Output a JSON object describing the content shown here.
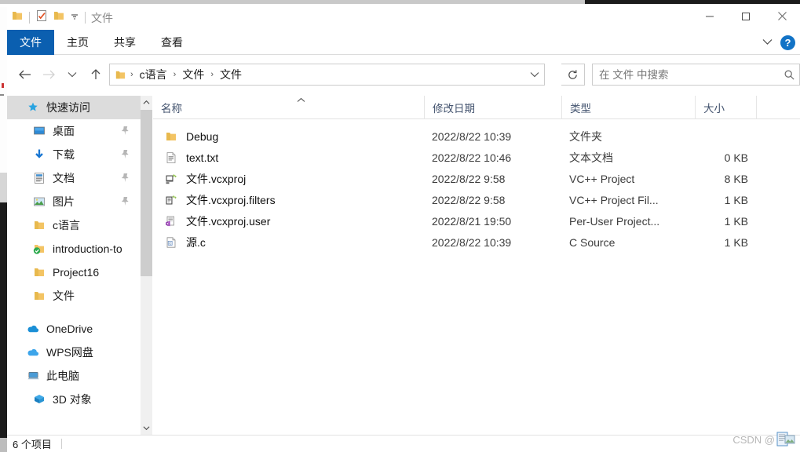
{
  "window": {
    "title": "文件",
    "quick_access": [
      {
        "name": "folder-icon",
        "label": "文件夹"
      },
      {
        "name": "properties-icon",
        "label": "属性"
      },
      {
        "name": "new-folder-icon",
        "label": "新建文件夹"
      },
      {
        "name": "customize-qat-caret",
        "label": "自定义快速访问工具栏"
      }
    ],
    "controls": [
      {
        "name": "minimize-button",
        "label": "最小化"
      },
      {
        "name": "maximize-button",
        "label": "最大化"
      },
      {
        "name": "close-button",
        "label": "关闭"
      }
    ]
  },
  "ribbon": {
    "tabs": [
      {
        "label": "文件",
        "active": true
      },
      {
        "label": "主页",
        "active": false
      },
      {
        "label": "共享",
        "active": false
      },
      {
        "label": "查看",
        "active": false
      }
    ],
    "expand_caret": "⌄",
    "help_label": "?"
  },
  "navigation": {
    "back_label": "←",
    "forward_label": "→",
    "recent_label": "⌄",
    "up_label": "↑",
    "refresh_label": "↻",
    "breadcrumb": [
      "c语言",
      "文件",
      "文件"
    ],
    "breadcrumb_separator": "›",
    "address_caret": "⌄"
  },
  "search": {
    "placeholder": "在 文件 中搜索",
    "value": "",
    "icon": "search-icon"
  },
  "sidebar": {
    "items": [
      {
        "label": "快速访问",
        "icon": "quick-access-star-icon",
        "selected": true,
        "pinned": false,
        "indent": false
      },
      {
        "label": "桌面",
        "icon": "desktop-icon",
        "selected": false,
        "pinned": true,
        "indent": true
      },
      {
        "label": "下载",
        "icon": "downloads-icon",
        "selected": false,
        "pinned": true,
        "indent": true
      },
      {
        "label": "文档",
        "icon": "documents-icon",
        "selected": false,
        "pinned": true,
        "indent": true
      },
      {
        "label": "图片",
        "icon": "pictures-icon",
        "selected": false,
        "pinned": true,
        "indent": true
      },
      {
        "label": "c语言",
        "icon": "folder-icon",
        "selected": false,
        "pinned": false,
        "indent": true
      },
      {
        "label": "introduction-to",
        "icon": "synced-folder-icon",
        "selected": false,
        "pinned": false,
        "indent": true
      },
      {
        "label": "Project16",
        "icon": "folder-icon",
        "selected": false,
        "pinned": false,
        "indent": true
      },
      {
        "label": "文件",
        "icon": "folder-icon",
        "selected": false,
        "pinned": false,
        "indent": true
      },
      {
        "label": "OneDrive",
        "icon": "onedrive-icon",
        "selected": false,
        "pinned": false,
        "indent": false
      },
      {
        "label": "WPS网盘",
        "icon": "wps-cloud-icon",
        "selected": false,
        "pinned": false,
        "indent": false
      },
      {
        "label": "此电脑",
        "icon": "this-pc-icon",
        "selected": false,
        "pinned": false,
        "indent": false
      },
      {
        "label": "3D 对象",
        "icon": "3d-objects-icon",
        "selected": false,
        "pinned": false,
        "indent": true
      }
    ],
    "scroll_up": "⌃",
    "scroll_down": "⌄"
  },
  "filelist": {
    "columns": [
      {
        "key": "name",
        "label": "名称",
        "sorted": "asc"
      },
      {
        "key": "date",
        "label": "修改日期",
        "sorted": ""
      },
      {
        "key": "type",
        "label": "类型",
        "sorted": ""
      },
      {
        "key": "size",
        "label": "大小",
        "sorted": ""
      }
    ],
    "sort_caret": "⌃",
    "rows": [
      {
        "name": "Debug",
        "icon": "folder-icon",
        "date": "2022/8/22 10:39",
        "type": "文件夹",
        "size": ""
      },
      {
        "name": "text.txt",
        "icon": "text-file-icon",
        "date": "2022/8/22 10:46",
        "type": "文本文档",
        "size": "0 KB"
      },
      {
        "name": "文件.vcxproj",
        "icon": "vcxproj-icon",
        "date": "2022/8/22 9:58",
        "type": "VC++ Project",
        "size": "8 KB"
      },
      {
        "name": "文件.vcxproj.filters",
        "icon": "vcxproj-filters-icon",
        "date": "2022/8/22 9:58",
        "type": "VC++ Project Fil...",
        "size": "1 KB"
      },
      {
        "name": "文件.vcxproj.user",
        "icon": "vcxproj-user-icon",
        "date": "2022/8/21 19:50",
        "type": "Per-User Project...",
        "size": "1 KB"
      },
      {
        "name": "源.c",
        "icon": "c-source-icon",
        "date": "2022/8/22 10:39",
        "type": "C Source",
        "size": "1 KB"
      }
    ]
  },
  "statusbar": {
    "item_count": "6 个项目"
  },
  "watermark": {
    "text": "CSDN @"
  },
  "colors": {
    "accent": "#0b5fb0",
    "help": "#1273c6",
    "header_text": "#44546f",
    "selection": "#dcdcdc",
    "folder": "#f5c96a"
  }
}
